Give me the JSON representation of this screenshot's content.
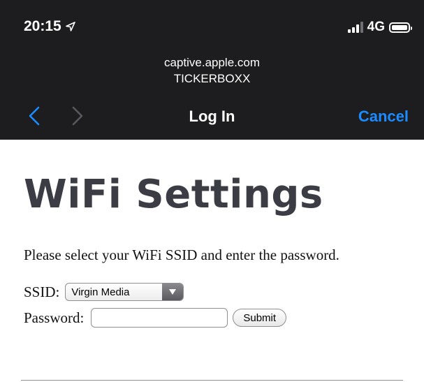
{
  "status_bar": {
    "time": "20:15",
    "location_icon": "location-arrow-icon",
    "network": "4G",
    "signal_icon": "signal-bars-icon",
    "battery_icon": "battery-icon"
  },
  "browser": {
    "url": "captive.apple.com",
    "host": "TICKERBOXX",
    "title": "Log In",
    "cancel_label": "Cancel",
    "back_icon": "chevron-left-icon",
    "forward_icon": "chevron-right-icon",
    "accent_color": "#1a8cff"
  },
  "page": {
    "heading": "WiFi Settings",
    "instructions": "Please select your WiFi SSID and enter the password.",
    "ssid_label": "SSID:",
    "ssid_value": "Virgin Media",
    "password_label": "Password:",
    "password_value": "",
    "submit_label": "Submit"
  }
}
